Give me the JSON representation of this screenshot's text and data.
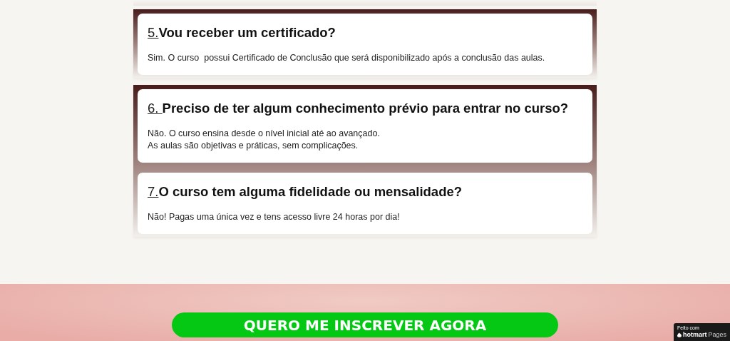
{
  "faq_groups": [
    {
      "items": [
        {
          "number": "5.",
          "question": "Vou receber um certificado?",
          "answer": [
            "Sim. O curso  possui Certificado de Conclusão que será disponibilizado após a conclusão das aulas."
          ]
        }
      ]
    },
    {
      "items": [
        {
          "number": "6. ",
          "question": "Preciso de ter algum conhecimento prévio para entrar no curso?",
          "answer": [
            "Não. O curso ensina desde o nível inicial até ao avançado.",
            "As aulas são objetivas e práticas, sem complicações."
          ]
        },
        {
          "number": "7.",
          "question": "O curso tem alguma fidelidade ou mensalidade?",
          "answer": [
            "Não! Pagas uma única vez e tens acesso livre 24 horas por dia!"
          ]
        }
      ]
    }
  ],
  "cta_button": "QUERO ME INSCREVER AGORA",
  "badge": {
    "caption": "Feito com",
    "brand": "hotmart",
    "product": "Pages"
  }
}
